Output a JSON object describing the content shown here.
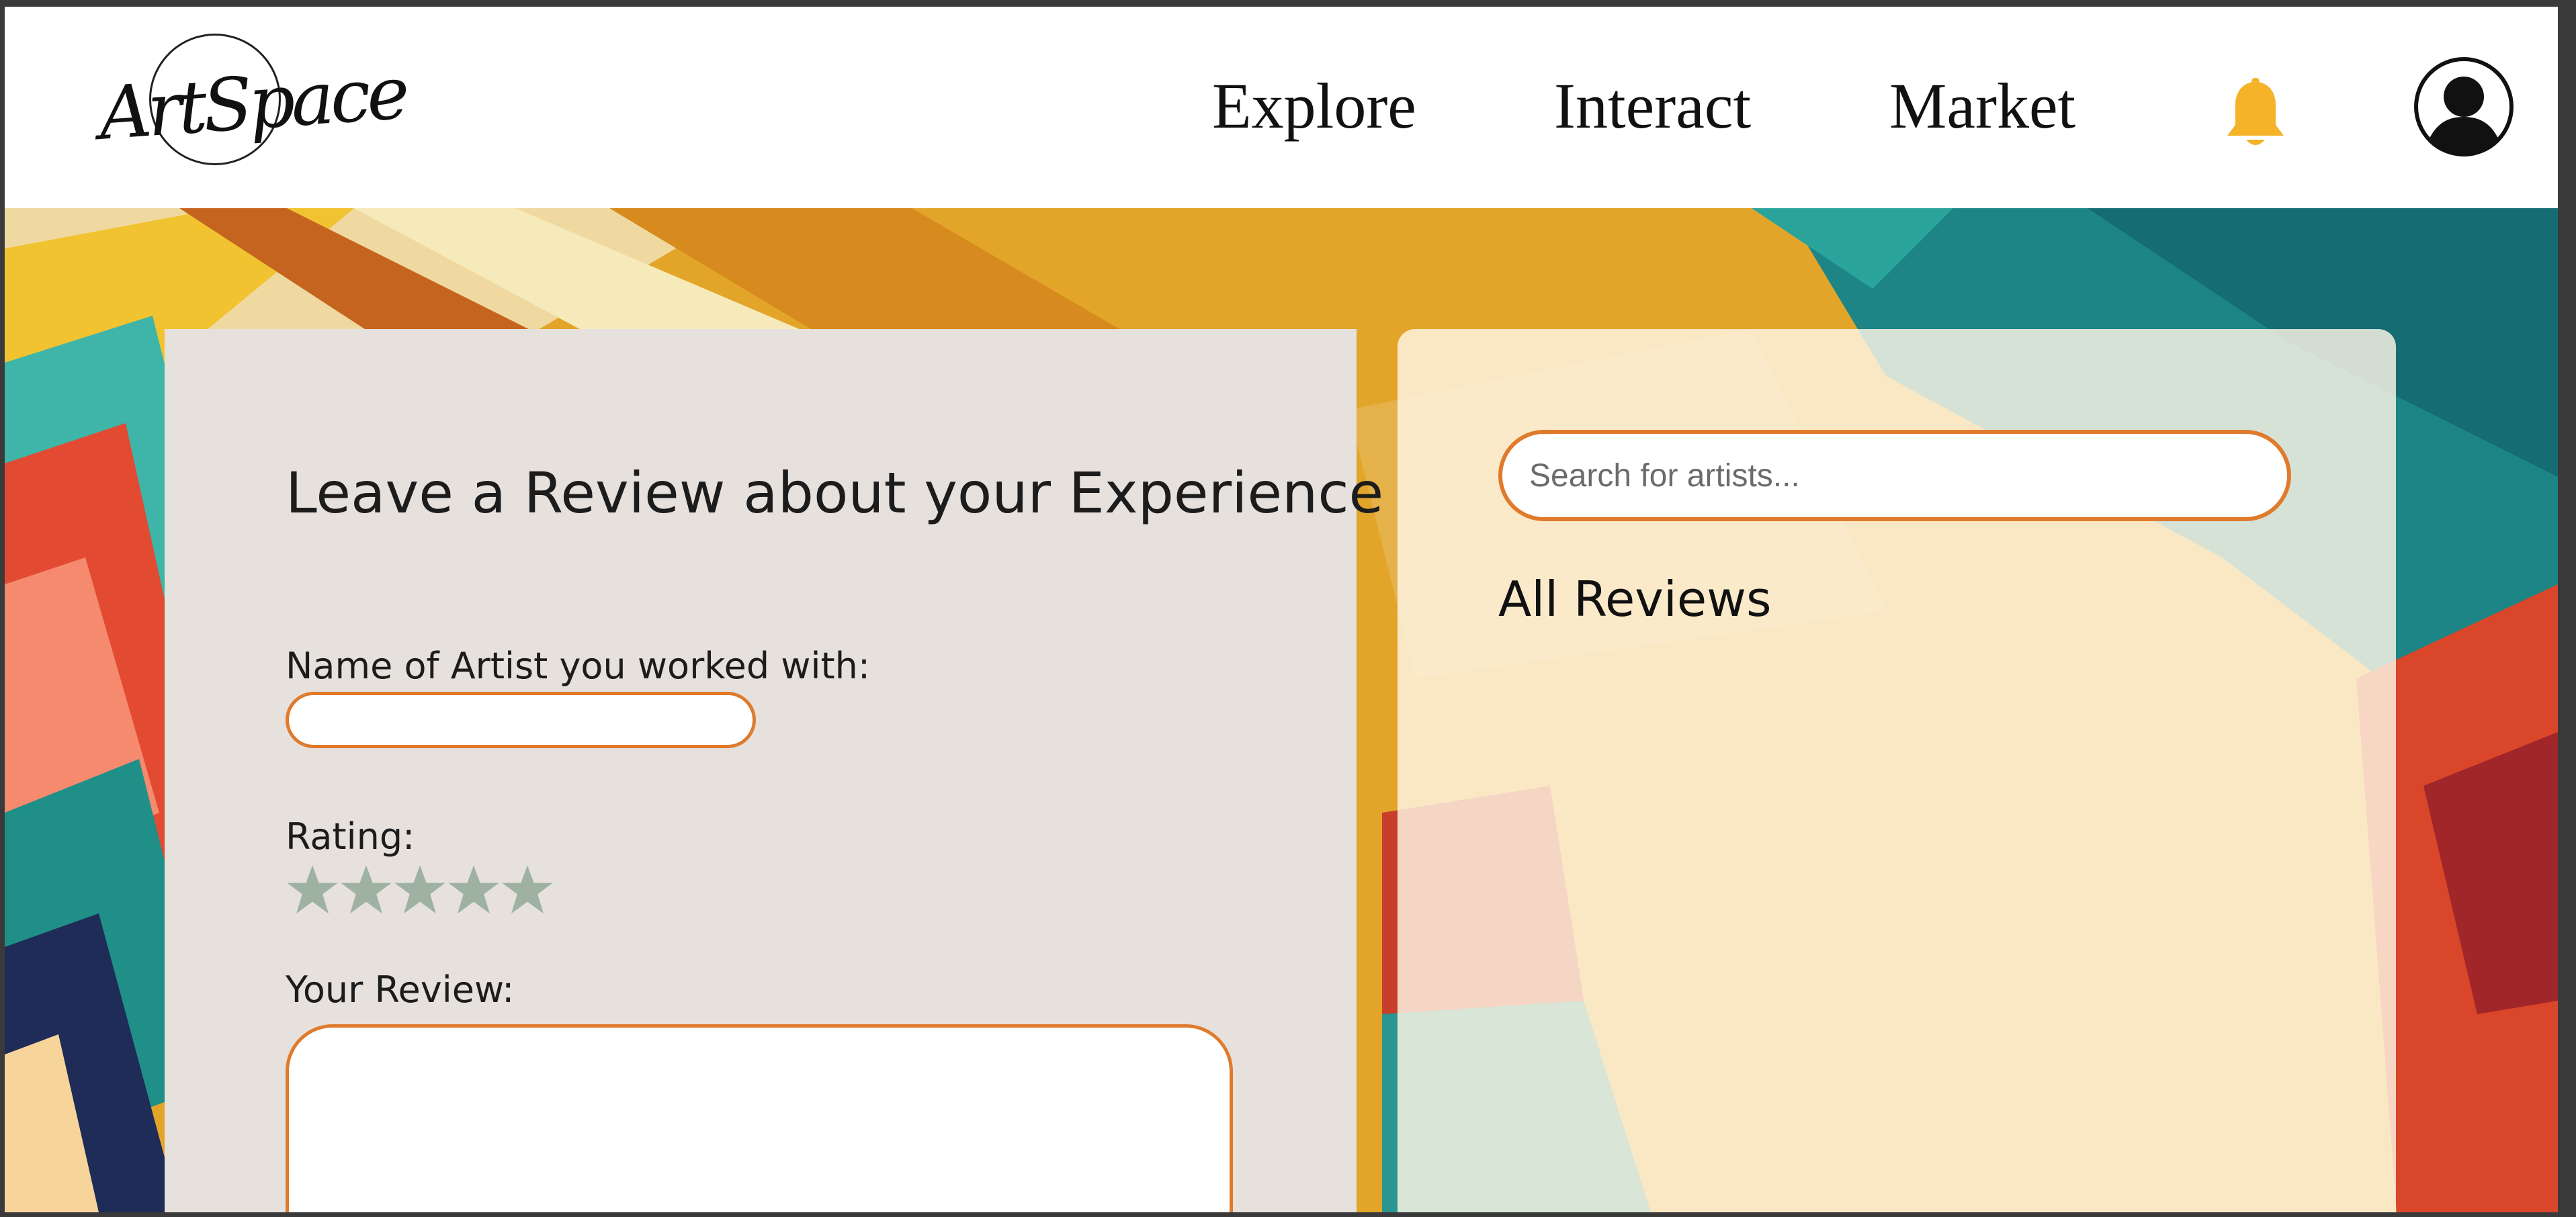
{
  "header": {
    "logo_text": "ArtSpace",
    "nav": [
      "Explore",
      "Interact",
      "Market"
    ],
    "notification_icon": "bell-icon",
    "profile_icon": "user-avatar-icon"
  },
  "review_form": {
    "title": "Leave a Review about your Experience",
    "artist_label": "Name of Artist you worked with:",
    "artist_value": "",
    "rating_label": "Rating:",
    "rating": 0,
    "rating_max": 5,
    "review_label": "Your Review:",
    "review_value": ""
  },
  "reviews": {
    "search_placeholder": "Search for artists...",
    "heading": "All Reviews"
  },
  "colors": {
    "accent": "#e07a2c",
    "bell": "#f4b328",
    "star_inactive": "#9fb2a2",
    "form_panel": "#e6e1dd"
  }
}
